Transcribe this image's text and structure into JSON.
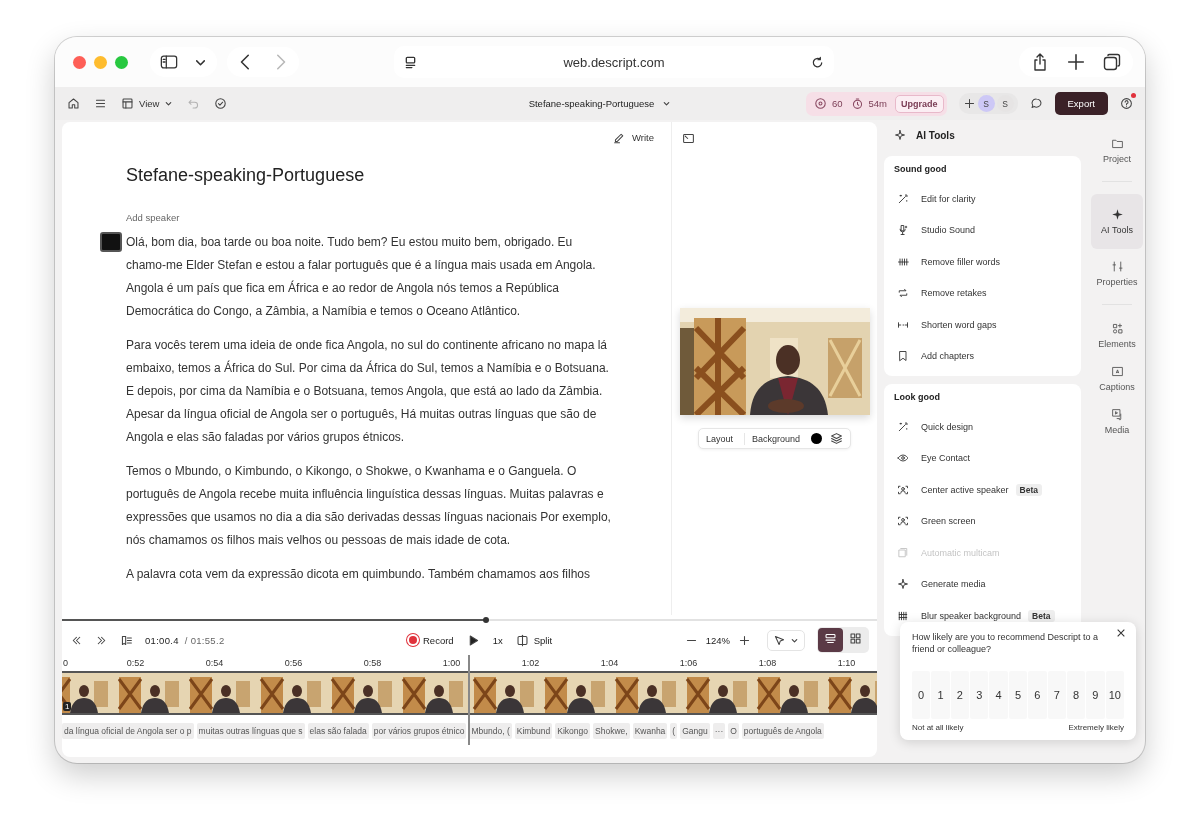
{
  "browser": {
    "url": "web.descript.com",
    "forward_disabled": true
  },
  "toolbar": {
    "view": "View",
    "undo_disabled": true,
    "project_title": "Stefane-speaking-Portuguese",
    "credits": "60",
    "minutes": "54m",
    "upgrade": "Upgrade",
    "collaborators": [
      {
        "initial": "S",
        "color": "#cdc8f6"
      },
      {
        "initial": "S",
        "color": "#e6e4e4"
      }
    ],
    "export": "Export",
    "help_notification": true
  },
  "editor": {
    "write": "Write",
    "title": "Stefane-speaking-Portuguese",
    "speaker": "Add speaker",
    "paragraphs": [
      "Olá, bom dia, boa tarde ou boa noite. Tudo bem? Eu estou muito bem, obrigado. Eu chamo-me Elder Stefan e estou a falar português que é a língua mais usada em Angola. Angola é um país que fica em África e ao redor de Angola nós temos a República Democrática do Congo, a Zâmbia, a Namíbia e temos o Oceano Atlântico.",
      "Para vocês terem uma ideia de onde fica Angola, no sul do continente africano no mapa lá embaixo, temos a África do Sul. Por cima da África do Sul, temos a Namíbia e o Botsuana. E depois, por cima da Namíbia e o Botsuana, temos Angola, que está ao lado da Zâmbia. Apesar da língua oficial de Angola ser o português, Há muitas outras línguas que são de Angola e elas são faladas por vários grupos étnicos.",
      "Temos o Mbundo, o Kimbundo, o Kikongo, o Shokwe, o Kwanhama e o Ganguela. O português de Angola recebe muita influência linguística dessas línguas. Muitas palavras e expressões que usamos no dia a dia são derivadas dessas línguas nacionais Por exemplo, nós chamamos os filhos mais velhos ou pessoas de mais idade de cota.",
      "A palavra cota vem da expressão dicota em quimbundo. Também chamamos aos filhos"
    ]
  },
  "preview": {
    "layout": "Layout",
    "background": "Background"
  },
  "timeline": {
    "scrub": {
      "level": 0.52
    },
    "current_time": "01:00.4",
    "duration": "/ 01:55.2",
    "record": "Record",
    "speed": "1x",
    "split": "Split",
    "zoom": "124%",
    "view_modes": [
      {
        "kind": "script",
        "selected": true
      },
      {
        "kind": "grid",
        "selected": false
      }
    ],
    "ruler": [
      "0",
      "0:52",
      "0:54",
      "0:56",
      "0:58",
      "1:00",
      "1:02",
      "1:04",
      "1:06",
      "1:08",
      "1:10"
    ],
    "track_number": "1",
    "words": [
      "da língua oficial de Angola ser o p",
      "muitas outras línguas que s",
      "elas são falada",
      "por vários grupos étnico",
      "Mbundo, (",
      "Kimbund",
      "Kikongo",
      "Shokwe,",
      "Kwanha",
      "(",
      "Gangu",
      "···",
      "O",
      "português de Angola"
    ]
  },
  "ai_tools": {
    "title": "AI Tools",
    "sections": [
      {
        "heading": "Sound good",
        "items": [
          {
            "label": "Edit for clarity",
            "disabled": false
          },
          {
            "label": "Studio Sound",
            "disabled": false
          },
          {
            "label": "Remove filler words",
            "disabled": false
          },
          {
            "label": "Remove retakes",
            "disabled": false
          },
          {
            "label": "Shorten word gaps",
            "disabled": false
          },
          {
            "label": "Add chapters",
            "disabled": false
          }
        ]
      },
      {
        "heading": "Look good",
        "items": [
          {
            "label": "Quick design",
            "disabled": false
          },
          {
            "label": "Eye Contact",
            "disabled": false
          },
          {
            "label": "Center active speaker",
            "disabled": false,
            "badge": "Beta"
          },
          {
            "label": "Green screen",
            "disabled": false
          },
          {
            "label": "Automatic multicam",
            "disabled": true
          },
          {
            "label": "Generate media",
            "disabled": false
          },
          {
            "label": "Blur speaker background",
            "disabled": false,
            "badge": "Beta"
          }
        ]
      }
    ]
  },
  "sidebar": [
    {
      "label": "Project",
      "selected": false
    },
    {
      "label": "AI Tools",
      "selected": true
    },
    {
      "label": "Properties",
      "selected": false
    },
    {
      "label": "Elements",
      "selected": false
    },
    {
      "label": "Captions",
      "selected": false
    },
    {
      "label": "Media",
      "selected": false
    }
  ],
  "survey": {
    "question": "How likely are you to recommend Descript to a friend or colleague?",
    "scale": [
      {
        "label": "0",
        "selected": false
      },
      {
        "label": "1",
        "selected": false
      },
      {
        "label": "2",
        "selected": false
      },
      {
        "label": "3",
        "selected": false
      },
      {
        "label": "4",
        "selected": false
      },
      {
        "label": "5",
        "selected": false
      },
      {
        "label": "6",
        "selected": false
      },
      {
        "label": "7",
        "selected": false
      },
      {
        "label": "8",
        "selected": false
      },
      {
        "label": "9",
        "selected": false
      },
      {
        "label": "10",
        "selected": false
      }
    ],
    "low_label": "Not at all likely",
    "high_label": "Extremely likely"
  }
}
